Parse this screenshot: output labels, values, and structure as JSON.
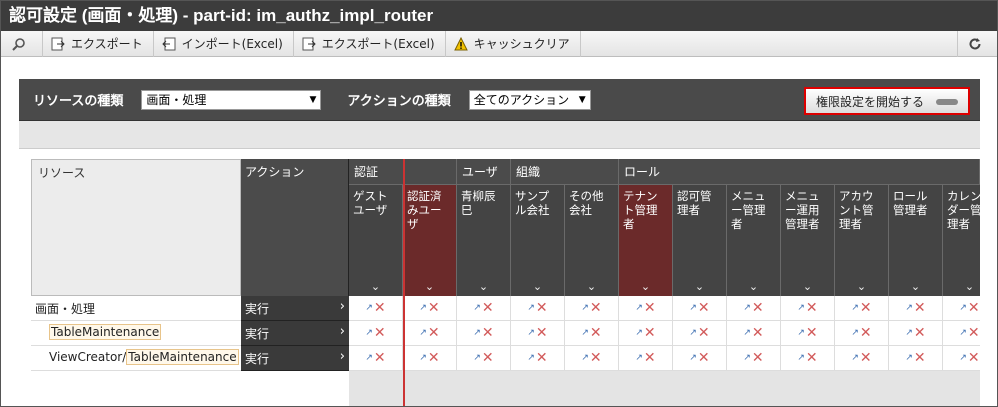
{
  "title": "認可設定 (画面・処理) - part-id: im_authz_impl_router",
  "toolbar": {
    "export": "エクスポート",
    "import_excel": "インポート(Excel)",
    "export_excel": "エクスポート(Excel)",
    "cache_clear": "キャッシュクリア"
  },
  "filter": {
    "resource_label": "リソースの種類",
    "resource_value": "画面・処理",
    "action_label": "アクションの種類",
    "action_value": "全てのアクション",
    "start_button": "権限設定を開始する"
  },
  "grid": {
    "resource_header": "リソース",
    "action_header": "アクション",
    "groups": [
      "認証",
      "ユーザ",
      "組織",
      "ロール"
    ],
    "columns": [
      {
        "label": "ゲストユーザ",
        "highlight": false
      },
      {
        "label": "認証済みユーザ",
        "highlight": true
      },
      {
        "label": "青柳辰巳",
        "highlight": false
      },
      {
        "label": "サンプル会社",
        "highlight": false
      },
      {
        "label": "その他会社",
        "highlight": false
      },
      {
        "label": "テナント管理者",
        "highlight": true
      },
      {
        "label": "認可管理者",
        "highlight": false
      },
      {
        "label": "メニュー管理者",
        "highlight": false
      },
      {
        "label": "メニュー運用管理者",
        "highlight": false
      },
      {
        "label": "アカウント管理者",
        "highlight": false
      },
      {
        "label": "ロール管理者",
        "highlight": false
      },
      {
        "label": "カレンダー管理者",
        "highlight": false
      }
    ],
    "rows": [
      {
        "resource": "画面・処理",
        "action": "実行",
        "sub": false
      },
      {
        "resource": "TableMaintenance",
        "action": "実行",
        "sub": true
      },
      {
        "resource_prefix": "ViewCreator/",
        "resource": "TableMaintenance",
        "action": "実行",
        "sub": true
      }
    ]
  }
}
